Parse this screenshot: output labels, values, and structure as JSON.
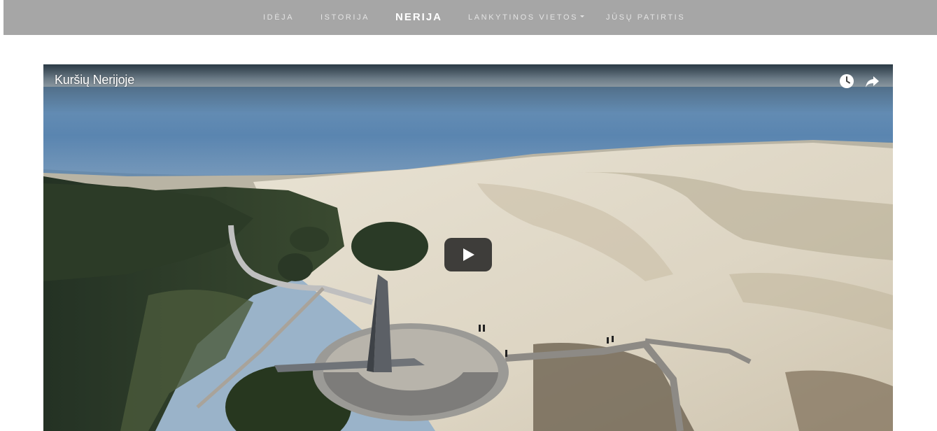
{
  "nav": {
    "items": [
      {
        "label": "IDĖJA"
      },
      {
        "label": "ISTORIJA"
      },
      {
        "label": "NERIJA"
      },
      {
        "label": "LANKYTINOS VIETOS"
      },
      {
        "label": "JŪSŲ PATIRTIS"
      }
    ]
  },
  "video": {
    "title": "Kuršių Nerijoje",
    "icons": {
      "watch_later": "clock-icon",
      "share": "share-icon",
      "play": "play-icon"
    }
  },
  "colors": {
    "navbar_bg": "#a6a6a6",
    "nav_text": "#e3e3e3",
    "nav_active": "#ffffff",
    "play_button": "#212121"
  }
}
